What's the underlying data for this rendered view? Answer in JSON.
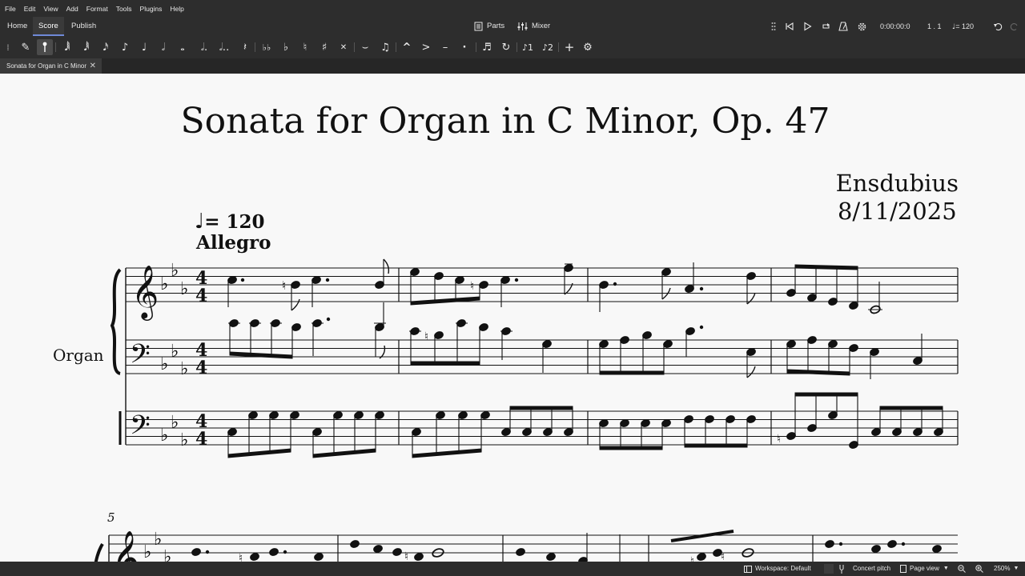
{
  "menu": [
    "File",
    "Edit",
    "View",
    "Add",
    "Format",
    "Tools",
    "Plugins",
    "Help"
  ],
  "nav_tabs": [
    {
      "label": "Home"
    },
    {
      "label": "Score",
      "active": true
    },
    {
      "label": "Publish"
    }
  ],
  "top_buttons": {
    "parts": "Parts",
    "mixer": "Mixer"
  },
  "playback": {
    "time": "0:00:00:0",
    "position": "1 . 1",
    "tempo": "= 120",
    "icons": [
      "grip-icon",
      "rewind-icon",
      "play-icon",
      "loop-icon",
      "metronome-icon",
      "playback-settings-icon"
    ]
  },
  "toolbar": {
    "items": [
      {
        "name": "grip-icon",
        "glyph": "⁞"
      },
      {
        "name": "note-input-pencil-icon",
        "glyph": "✎"
      },
      {
        "name": "note-input-mode-icon",
        "glyph": "|",
        "active": true
      },
      {
        "name": "sixty-fourth-note-icon",
        "glyph": "𝅘𝅥𝅲"
      },
      {
        "name": "thirty-second-note-icon",
        "glyph": "𝅘𝅥𝅱"
      },
      {
        "name": "sixteenth-note-icon",
        "glyph": "𝅘𝅥𝅯"
      },
      {
        "name": "eighth-note-icon",
        "glyph": "♪"
      },
      {
        "name": "quarter-note-icon",
        "glyph": "♩"
      },
      {
        "name": "half-note-icon",
        "glyph": "𝅗𝅥"
      },
      {
        "name": "whole-note-icon",
        "glyph": "𝅝"
      },
      {
        "name": "augmentation-dot-icon",
        "glyph": "𝅗𝅥."
      },
      {
        "name": "double-dot-icon",
        "glyph": "𝅗𝅥.."
      },
      {
        "name": "rest-icon",
        "glyph": "𝄽"
      },
      {
        "name": "double-flat-icon",
        "glyph": "♭♭"
      },
      {
        "name": "flat-icon",
        "glyph": "♭"
      },
      {
        "name": "natural-icon",
        "glyph": "♮"
      },
      {
        "name": "sharp-icon",
        "glyph": "♯"
      },
      {
        "name": "double-sharp-icon",
        "glyph": "✕"
      },
      {
        "name": "tie-icon",
        "glyph": "⌣"
      },
      {
        "name": "slur-icon",
        "glyph": "♫"
      },
      {
        "name": "marcato-icon",
        "glyph": "^"
      },
      {
        "name": "accent-icon",
        "glyph": ">"
      },
      {
        "name": "tenuto-icon",
        "glyph": "–"
      },
      {
        "name": "staccato-icon",
        "glyph": "·"
      },
      {
        "name": "tuplet-icon",
        "glyph": "♬"
      },
      {
        "name": "flip-direction-icon",
        "glyph": "↻"
      },
      {
        "name": "voice-1-icon",
        "glyph": "♪1"
      },
      {
        "name": "voice-2-icon",
        "glyph": "♪2"
      },
      {
        "name": "add-icon",
        "glyph": "+"
      },
      {
        "name": "toolbar-settings-icon",
        "glyph": "⚙"
      }
    ]
  },
  "document_tab": {
    "label": "Sonata for Organ in C Minor"
  },
  "score": {
    "title": "Sonata for Organ in C Minor, Op. 47",
    "composer": "Ensdubius",
    "date": "8/11/2025",
    "tempo_value": "= 120",
    "tempo_text": "Allegro",
    "instrument": "Organ",
    "time_signature": "4/4",
    "key_signature": "3 flats",
    "second_system_measure_number": "5"
  },
  "status": {
    "workspace": "Workspace: Default",
    "concert_pitch": "Concert pitch",
    "view_mode": "Page view",
    "zoom": "250%"
  },
  "colors": {
    "chrome": "#2d2d2d",
    "accent": "#6f8ad8",
    "paper": "#f8f8f8",
    "ink": "#111111"
  }
}
